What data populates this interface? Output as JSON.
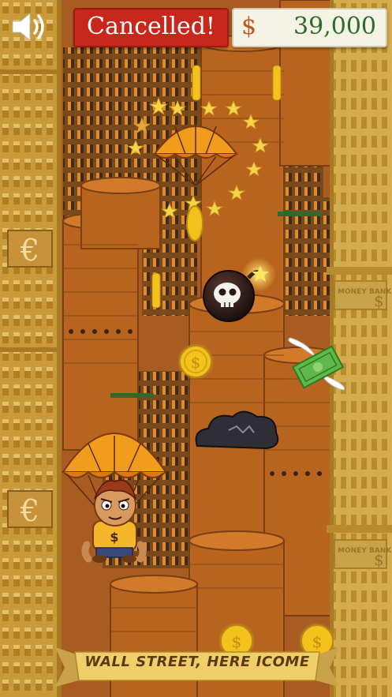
{
  "hud": {
    "status_label": "Cancelled!",
    "currency_symbol": "$",
    "money_amount": "39,000",
    "sound_icon": "speaker-icon"
  },
  "scene": {
    "left_building_symbol": "€",
    "right_building_sign": "MONEY BANK",
    "right_building_symbol": "$",
    "coin_symbol": "$",
    "player_shirt_symbol": "$"
  },
  "banner": {
    "text": "WALL STREET, HERE ICOME"
  },
  "colors": {
    "status_bg": "#c8281c",
    "money_bg": "#f5f2e6",
    "money_text": "#2e6b2a",
    "building_gold": "#c99a3a",
    "coin_gold": "#f3c21d",
    "parachute_orange": "#f29c1e",
    "tower_orange": "#b8641f"
  }
}
